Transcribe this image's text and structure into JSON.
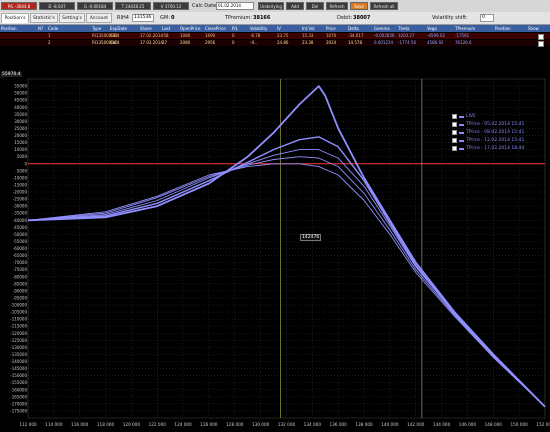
{
  "toolbar": {
    "buttons": [
      "P/L -3044.8",
      "D -8.047",
      "G -0.00184",
      "T 24428.25",
      "V 3700.12"
    ],
    "calc_date_label": "Calc Date",
    "calc_date_value": "01.02.2014",
    "right_buttons": [
      "Underlying",
      "Add",
      "Del",
      "Refresh",
      "Save",
      "Refresh all"
    ]
  },
  "tabs": [
    "Position's",
    "Statistic's",
    "Setting's",
    "Account"
  ],
  "info": {
    "ri_label": "RIH4",
    "ri_value": "131536",
    "gm_label": "GM:",
    "gm_value": "0",
    "tpremium_label": "TPremium:",
    "tpremium_value": "38166",
    "debit_label": "Debit:",
    "debit_value": "38007",
    "vol_shift_label": "Volatility shift:",
    "vol_shift_value": "0"
  },
  "table": {
    "headers": [
      "Position",
      "N?",
      "Code",
      "Type",
      "ExpDate",
      "Share",
      "Last",
      "OpenPrice",
      "ClosePrice",
      "P/L",
      "Volatility",
      "IV",
      "Int.Vol",
      "Price",
      "Delta",
      "Gamma",
      "Theta",
      "Vega",
      "TPremium",
      "Position",
      "Show"
    ],
    "rows": [
      [
        "",
        "1",
        "RI135000BD4",
        "Call",
        "17.02.2014",
        "-58",
        "1080",
        "1690",
        "0",
        "-6.78",
        "23.75",
        "15.33",
        "1070",
        "-34.017",
        "-0.002856",
        "3203.27",
        "-4599.02",
        "-17561",
        "",
        ""
      ],
      [
        "",
        "2",
        "RI135000BC4",
        "Call",
        "17.03.2014",
        "37",
        "2080",
        "2956",
        "0",
        "-4...",
        "24.86",
        "23.38",
        "2024",
        "14.578",
        "0.001234",
        "-1774.56",
        "4586.92",
        "76126.6",
        "",
        ""
      ]
    ]
  },
  "chart_data": {
    "type": "line",
    "title": "55970.4",
    "x": [
      112000,
      114000,
      116000,
      118000,
      120000,
      122000,
      124000,
      126000,
      128000,
      130000,
      132000,
      134000,
      136000,
      138000,
      140000,
      142000,
      144000,
      146000,
      148000,
      150000,
      152000
    ],
    "x_tick_labels": [
      "112 000",
      "114 000",
      "116 000",
      "118 000",
      "120 000",
      "122 000",
      "124 000",
      "126 000",
      "128 000",
      "130 000",
      "132 000",
      "134 000",
      "136 000",
      "138 000",
      "140 000",
      "142 000",
      "144 000",
      "146 000",
      "148 000",
      "150 000",
      "152 000"
    ],
    "ylim": [
      -180000,
      60000
    ],
    "y_ticks": [
      55000,
      50000,
      45000,
      40000,
      35000,
      30000,
      25000,
      20000,
      15000,
      10000,
      5000,
      0,
      -5000,
      -10000,
      -15000,
      -20000,
      -25000,
      -30000,
      -35000,
      -40000,
      -45000,
      -50000,
      -55000,
      -60000,
      -65000,
      -70000,
      -75000,
      -80000,
      -85000,
      -90000,
      -95000,
      -100000,
      -105000,
      -110000,
      -115000,
      -120000,
      -125000,
      -130000,
      -135000,
      -140000,
      -145000,
      -150000,
      -155000,
      -160000,
      -165000,
      -170000,
      -175000
    ],
    "series": [
      {
        "name": "LIVE",
        "x": [
          112000,
          118000,
          122000,
          126000,
          129000,
          131000,
          133000,
          134500,
          135000,
          136000,
          138000,
          140000,
          142000,
          145000,
          148000,
          152000
        ],
        "values": [
          -40000,
          -38000,
          -30000,
          -14000,
          5000,
          22000,
          42000,
          55000,
          48000,
          25000,
          -10000,
          -40000,
          -70000,
          -105000,
          -135000,
          -172000
        ]
      },
      {
        "name": "TPrice - 05.02.2014 15:41",
        "x": [
          112000,
          118000,
          122000,
          126000,
          129000,
          131000,
          133000,
          134500,
          136000,
          138000,
          140000,
          142000,
          145000,
          148000,
          152000
        ],
        "values": [
          -40000,
          -37000,
          -28000,
          -12000,
          1000,
          10000,
          17000,
          19000,
          12000,
          -12000,
          -42000,
          -72000,
          -106000,
          -136000,
          -172000
        ]
      },
      {
        "name": "TPrice - 08.02.2014 15:41",
        "x": [
          112000,
          118000,
          122000,
          126000,
          129000,
          131000,
          133000,
          134500,
          136000,
          138000,
          140000,
          142000,
          145000,
          148000,
          152000
        ],
        "values": [
          -40000,
          -36000,
          -26000,
          -10000,
          0,
          6000,
          10000,
          10000,
          4000,
          -16000,
          -44000,
          -73000,
          -106000,
          -136000,
          -172000
        ]
      },
      {
        "name": "TPrice - 12.02.2014 15:41",
        "x": [
          112000,
          118000,
          122000,
          126000,
          129000,
          131000,
          133000,
          134500,
          136000,
          138000,
          140000,
          142000,
          145000,
          148000,
          152000
        ],
        "values": [
          -40000,
          -35000,
          -24000,
          -9000,
          -1000,
          3000,
          5000,
          4000,
          -2000,
          -21000,
          -47000,
          -75000,
          -107000,
          -137000,
          -172000
        ]
      },
      {
        "name": "TPrice - 17.02.2014 18:44",
        "x": [
          112000,
          118000,
          122000,
          126000,
          129000,
          131000,
          133000,
          134500,
          136000,
          138000,
          140000,
          142000,
          145000,
          148000,
          152000
        ],
        "values": [
          -40000,
          -34000,
          -23000,
          -8000,
          -2000,
          0,
          0,
          -2000,
          -8000,
          -26000,
          -50000,
          -77000,
          -108000,
          -137000,
          -172000
        ]
      }
    ],
    "annotation": "142476",
    "legend_position": "top-right",
    "colors": {
      "line": "#8f8fff",
      "zero_line": "#ff3b3b",
      "vline1": "#9a9a3a",
      "vline2": "#cfcfa0",
      "grid": "#555555"
    }
  }
}
